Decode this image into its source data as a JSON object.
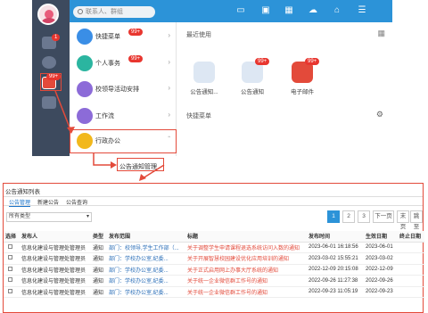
{
  "search": {
    "placeholder": "联系人、群组"
  },
  "rail": {
    "badge_1": "1",
    "badge_2": "99+"
  },
  "menu": {
    "items": [
      {
        "label": "快捷菜单",
        "badge": "99+"
      },
      {
        "label": "个人事务",
        "badge": "99+"
      },
      {
        "label": "校领导活动安排",
        "badge": ""
      },
      {
        "label": "工作流",
        "badge": ""
      },
      {
        "label": "行政办公",
        "badge": ""
      }
    ],
    "sub_item": "公告通知管理"
  },
  "right": {
    "recent_title": "最近使用",
    "shortcut_title": "快捷菜单",
    "apps": [
      {
        "label": "公告通知...",
        "badge": ""
      },
      {
        "label": "公告通知",
        "badge": "99+"
      },
      {
        "label": "电子邮件",
        "badge": "99+"
      }
    ]
  },
  "panel": {
    "title": "公告通知列表",
    "tabs": [
      "公告管理",
      "新建公告",
      "公告查询"
    ],
    "filter": "所有类型",
    "pages": [
      "1",
      "2",
      "3",
      "下一页",
      "末页",
      "跳至"
    ],
    "columns": [
      "选择",
      "发布人",
      "类型",
      "发布范围",
      "标题",
      "发布时间",
      "生效日期",
      "终止日期"
    ],
    "rows": [
      [
        "信息化建设与管理处管理员",
        "通知",
        "部门：校领导,学生工作部（...",
        "关于调整学生申请课程退选系统访问入数的通知",
        "2023-06-01 16:18:56",
        "2023-06-01",
        ""
      ],
      [
        "信息化建设与管理处管理员",
        "通知",
        "部门：学校办公室,纪委...",
        "关于开展智慧校园建设优化应用培训的通知",
        "2023-03-02 15:55:21",
        "2023-03-02",
        ""
      ],
      [
        "信息化建设与管理处管理员",
        "通知",
        "部门：学校办公室,纪委...",
        "关于正式启用网上办事大厅系统的通知",
        "2022-12-09 20:15:08",
        "2022-12-09",
        ""
      ],
      [
        "信息化建设与管理处管理员",
        "通知",
        "部门：学校办公室,纪委...",
        "关于统一企业微信群工作号的通知",
        "2022-09-26 11:27:38",
        "2022-09-26",
        ""
      ],
      [
        "信息化建设与管理处管理员",
        "通知",
        "部门：学校办公室,纪委...",
        "关于统一企业微信群工作号的通知",
        "2022-09-23 11:05:19",
        "2022-09-23",
        ""
      ]
    ]
  },
  "colors": {
    "topbar": "#2c93d8",
    "rail": "#3d4a5e",
    "highlight": "#e34a3a"
  }
}
